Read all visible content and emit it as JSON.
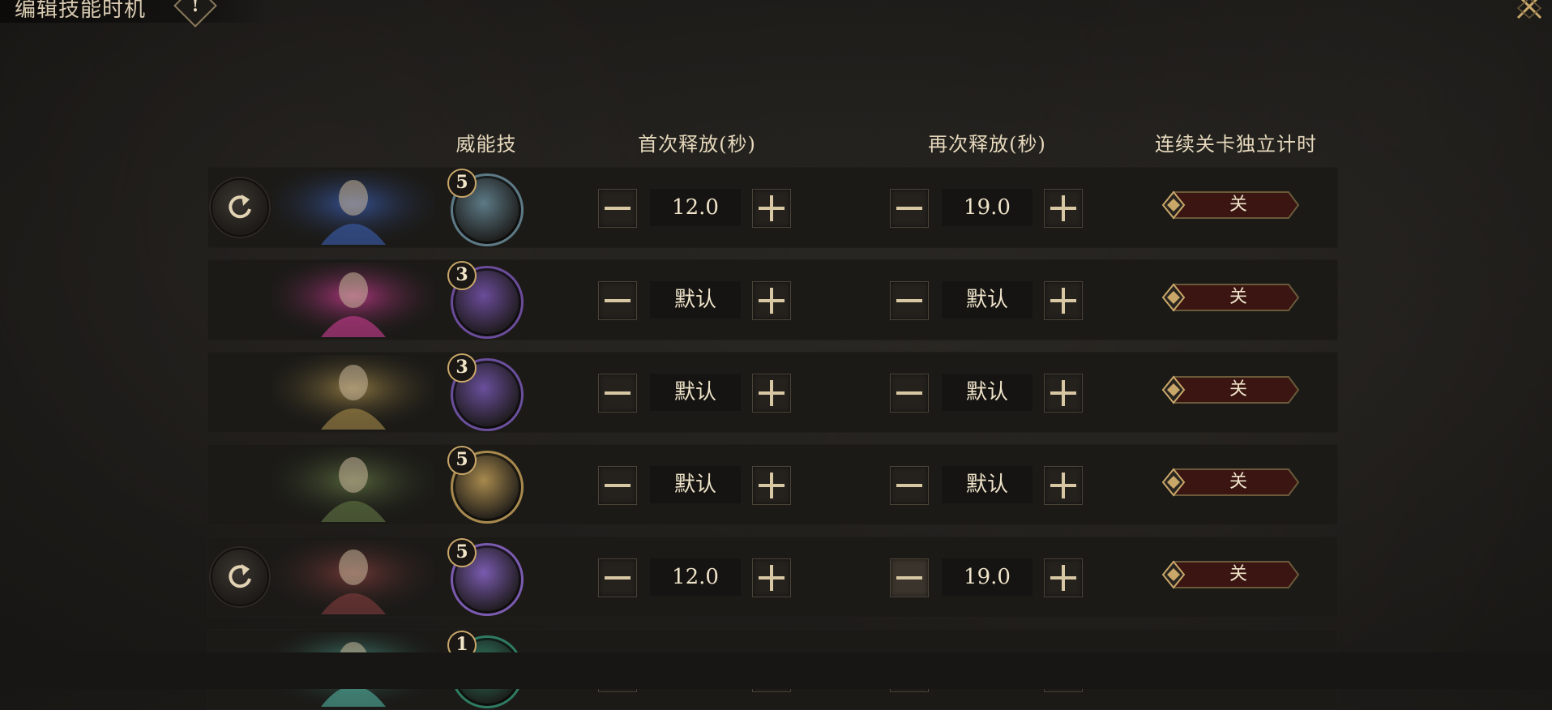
{
  "header": {
    "title": "编辑技能时机",
    "help_glyph": "!"
  },
  "columns": {
    "skill": "威能技",
    "first_cast": "首次释放(秒)",
    "recast": "再次释放(秒)",
    "independent_timer": "连续关卡独立计时"
  },
  "rows": [
    {
      "has_reset": true,
      "level": "5",
      "first": "12.0",
      "recast": "19.0",
      "toggle": "关",
      "skill_color": "#5d7a86",
      "portrait_color": "#3a5aa8"
    },
    {
      "has_reset": false,
      "level": "3",
      "first": "默认",
      "recast": "默认",
      "toggle": "关",
      "skill_color": "#6b4c9a",
      "portrait_color": "#c03a8a"
    },
    {
      "has_reset": false,
      "level": "3",
      "first": "默认",
      "recast": "默认",
      "toggle": "关",
      "skill_color": "#6a4f9c",
      "portrait_color": "#9c8347"
    },
    {
      "has_reset": false,
      "level": "5",
      "first": "默认",
      "recast": "默认",
      "toggle": "关",
      "skill_color": "#a88a4e",
      "portrait_color": "#5e7040"
    },
    {
      "has_reset": true,
      "level": "5",
      "first": "12.0",
      "recast": "19.0",
      "toggle": "关",
      "skill_color": "#7a5bb0",
      "portrait_color": "#7a3b3a"
    },
    {
      "has_reset": false,
      "level": "1",
      "first": "",
      "recast": "",
      "toggle": "",
      "skill_color": "#2f7a62",
      "portrait_color": "#4fa896"
    }
  ],
  "colors": {
    "accent_gold": "#c9a769",
    "toggle_off_fill": "#3a1512",
    "row_bg": "#1b1a17"
  }
}
